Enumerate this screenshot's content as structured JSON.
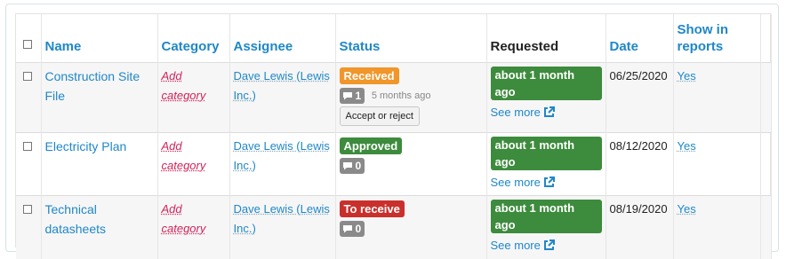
{
  "table": {
    "headers": {
      "name": "Name",
      "category": "Category",
      "assignee": "Assignee",
      "status": "Status",
      "requested": "Requested",
      "date": "Date",
      "show_in_reports": "Show in reports"
    },
    "rows": [
      {
        "name": "Construction Site File",
        "category": "Add category",
        "assignee": "Dave Lewis (Lewis Inc.)",
        "status": "Received",
        "status_color": "#f0962a",
        "comments": "1",
        "comment_ago": "5 months ago",
        "action": "Accept or reject",
        "requested": "about 1 month ago",
        "see_more": "See more",
        "date": "06/25/2020",
        "show_in_reports": "Yes"
      },
      {
        "name": "Electricity Plan",
        "category": "Add category",
        "assignee": "Dave Lewis (Lewis Inc.)",
        "status": "Approved",
        "status_color": "#3d8b3d",
        "comments": "0",
        "requested": "about 1 month ago",
        "see_more": "See more",
        "date": "08/12/2020",
        "show_in_reports": "Yes"
      },
      {
        "name": "Technical datasheets",
        "category": "Add category",
        "assignee": "Dave Lewis (Lewis Inc.)",
        "status": "To receive",
        "status_color": "#c9302c",
        "comments": "0",
        "requested": "about 1 month ago",
        "see_more": "See more",
        "date": "08/19/2020",
        "show_in_reports": "Yes"
      }
    ]
  },
  "icons": {
    "comment": "comment-icon",
    "external_link": "external-link-icon"
  }
}
